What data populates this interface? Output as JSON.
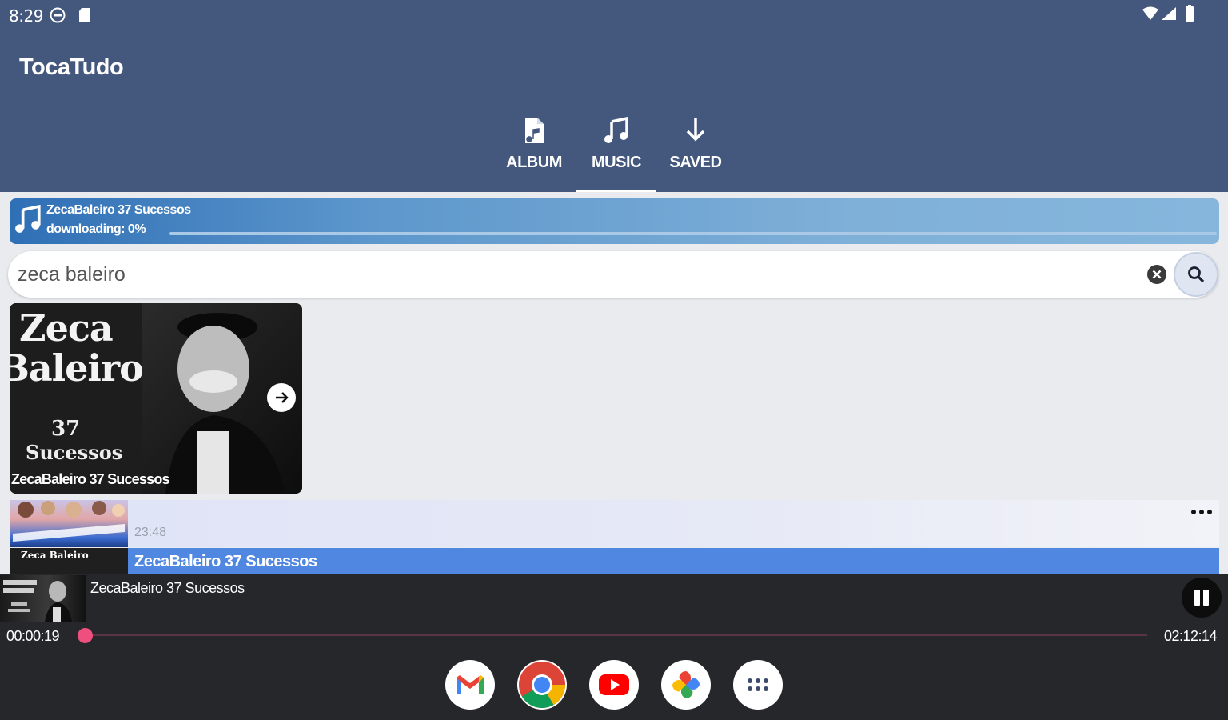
{
  "status_bar": {
    "time": "8:29"
  },
  "app": {
    "title": "TocaTudo"
  },
  "tabs": [
    {
      "label": "ALBUM",
      "icon": "file-music-icon",
      "selected": false
    },
    {
      "label": "MUSIC",
      "icon": "music-note-icon",
      "selected": true
    },
    {
      "label": "SAVED",
      "icon": "download-arrow-icon",
      "selected": false
    }
  ],
  "download": {
    "title": "ZecaBaleiro 37 Sucessos",
    "status": "downloading: 0%",
    "progress_percent": 0
  },
  "search": {
    "value": "zeca baleiro"
  },
  "album_card": {
    "art_line1": "Zeca",
    "art_line2": "Baleiro",
    "art_number": "37",
    "art_word": "Sucessos",
    "caption": "ZecaBaleiro 37 Sucessos"
  },
  "results": [
    {
      "duration": "23:48"
    },
    {
      "title": "ZecaBaleiro 37 Sucessos",
      "thumb_text": "Zeca Baleiro"
    }
  ],
  "player": {
    "title": "ZecaBaleiro 37 Sucessos",
    "elapsed": "00:00:19",
    "total": "02:12:14",
    "progress_fraction": 0.0024
  },
  "dock": [
    {
      "app": "gmail-icon"
    },
    {
      "app": "chrome-icon"
    },
    {
      "app": "youtube-icon"
    },
    {
      "app": "photos-icon"
    },
    {
      "app": "app-drawer-icon"
    }
  ],
  "colors": {
    "app_bar": "#44577c",
    "accent_pink": "#ef4f7f",
    "selected_row": "#5087e0",
    "player_bg": "#25272b"
  }
}
